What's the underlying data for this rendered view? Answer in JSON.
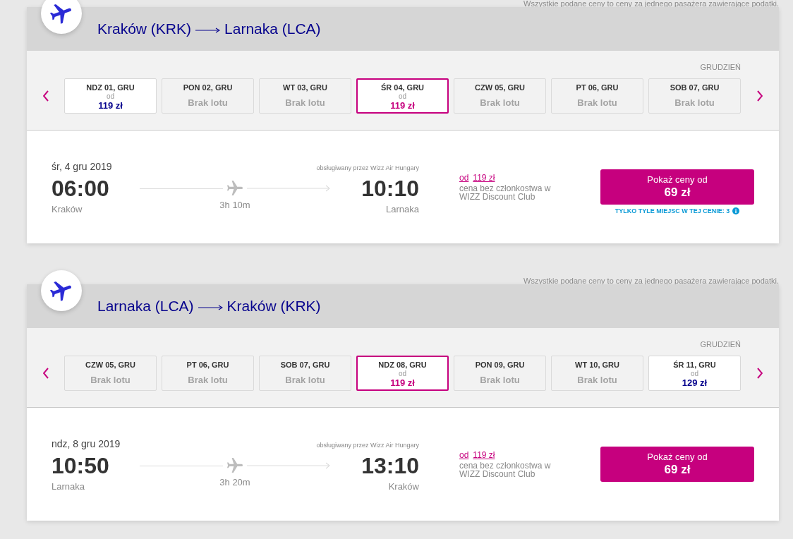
{
  "legs": [
    {
      "price_note": "Wszystkie podane ceny to ceny za jednego pasażera zawierające podatki.",
      "route": {
        "origin": "Kraków (KRK)",
        "destination": "Larnaka (LCA)"
      },
      "calendar": {
        "month": "GRUDZIEŃ",
        "days": [
          {
            "kind": "price",
            "label": "NDZ 01, GRU",
            "prefix": "od",
            "price": "119 zł",
            "selected": false
          },
          {
            "kind": "no_flight",
            "label": "PON 02, GRU",
            "status": "Brak lotu",
            "selected": false
          },
          {
            "kind": "no_flight",
            "label": "WT 03, GRU",
            "status": "Brak lotu",
            "selected": false
          },
          {
            "kind": "price",
            "label": "ŚR 04, GRU",
            "prefix": "od",
            "price": "119 zł",
            "selected": true
          },
          {
            "kind": "no_flight",
            "label": "CZW 05, GRU",
            "status": "Brak lotu",
            "selected": false
          },
          {
            "kind": "no_flight",
            "label": "PT 06, GRU",
            "status": "Brak lotu",
            "selected": false
          },
          {
            "kind": "no_flight",
            "label": "SOB 07, GRU",
            "status": "Brak lotu",
            "selected": false
          }
        ]
      },
      "flight": {
        "date": "śr, 4 gru 2019",
        "operator": "obsługiwany przez Wizz Air Hungary",
        "departure_time": "06:00",
        "departure_city": "Kraków",
        "duration": "3h 10m",
        "arrival_time": "10:10",
        "arrival_city": "Larnaka",
        "price_prefix": "od",
        "price": "119 zł",
        "membership_note": "cena bez członkostwa w WIZZ Discount Club",
        "button": {
          "label": "Pokaż ceny od",
          "price": "69 zł"
        },
        "seats_left": "TYLKO TYLE MIEJSC W TEJ CENIE: 3"
      }
    },
    {
      "price_note": "Wszystkie podane ceny to ceny za jednego pasażera zawierające podatki.",
      "route": {
        "origin": "Larnaka (LCA)",
        "destination": "Kraków (KRK)"
      },
      "calendar": {
        "month": "GRUDZIEŃ",
        "days": [
          {
            "kind": "no_flight",
            "label": "CZW 05, GRU",
            "status": "Brak lotu",
            "selected": false
          },
          {
            "kind": "no_flight",
            "label": "PT 06, GRU",
            "status": "Brak lotu",
            "selected": false
          },
          {
            "kind": "no_flight",
            "label": "SOB 07, GRU",
            "status": "Brak lotu",
            "selected": false
          },
          {
            "kind": "price",
            "label": "NDZ 08, GRU",
            "prefix": "od",
            "price": "119 zł",
            "selected": true
          },
          {
            "kind": "no_flight",
            "label": "PON 09, GRU",
            "status": "Brak lotu",
            "selected": false
          },
          {
            "kind": "no_flight",
            "label": "WT 10, GRU",
            "status": "Brak lotu",
            "selected": false
          },
          {
            "kind": "price",
            "label": "ŚR 11, GRU",
            "prefix": "od",
            "price": "129 zł",
            "selected": false
          }
        ]
      },
      "flight": {
        "date": "ndz, 8 gru 2019",
        "operator": "obsługiwany przez Wizz Air Hungary",
        "departure_time": "10:50",
        "departure_city": "Larnaka",
        "duration": "3h 20m",
        "arrival_time": "13:10",
        "arrival_city": "Kraków",
        "price_prefix": "od",
        "price": "119 zł",
        "membership_note": "cena bez członkostwa w WIZZ Discount Club",
        "button": {
          "label": "Pokaż ceny od",
          "price": "69 zł"
        }
      }
    }
  ]
}
